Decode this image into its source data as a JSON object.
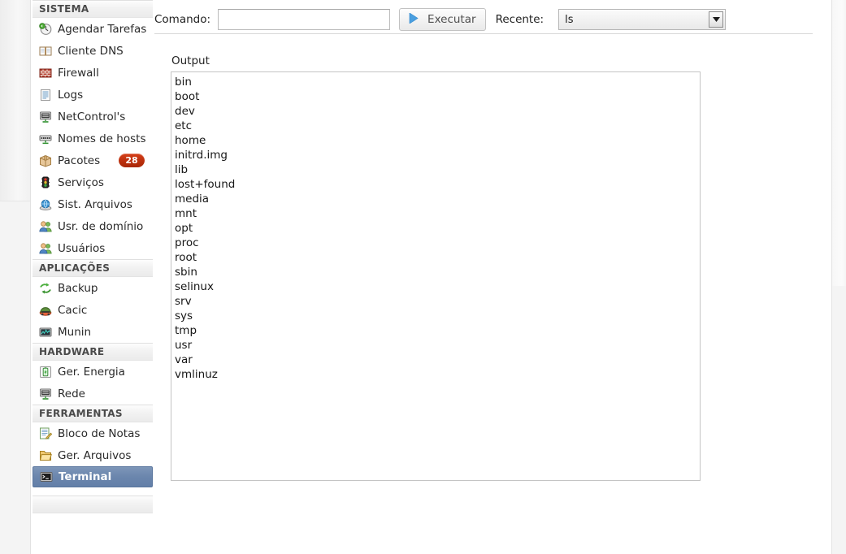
{
  "sidebar": {
    "sections": [
      {
        "title": "SISTEMA",
        "items": [
          {
            "label": "Agendar Tarefas",
            "icon": "clock-icon",
            "name": "sidebar-item-agendar-tarefas"
          },
          {
            "label": "Cliente DNS",
            "icon": "book-icon",
            "name": "sidebar-item-cliente-dns"
          },
          {
            "label": "Firewall",
            "icon": "brick-wall-icon",
            "name": "sidebar-item-firewall"
          },
          {
            "label": "Logs",
            "icon": "document-lines-icon",
            "name": "sidebar-item-logs"
          },
          {
            "label": "NetControl's",
            "icon": "monitor-network-icon",
            "name": "sidebar-item-netcontrols"
          },
          {
            "label": "Nomes de hosts",
            "icon": "hosts-icon",
            "name": "sidebar-item-nomes-de-hosts"
          },
          {
            "label": "Pacotes",
            "icon": "package-box-icon",
            "name": "sidebar-item-pacotes",
            "badge": "28"
          },
          {
            "label": "Serviços",
            "icon": "traffic-light-icon",
            "name": "sidebar-item-servicos"
          },
          {
            "label": "Sist. Arquivos",
            "icon": "disk-globe-icon",
            "name": "sidebar-item-sist-arquivos"
          },
          {
            "label": "Usr. de domínio",
            "icon": "users-icon",
            "name": "sidebar-item-usr-de-dominio"
          },
          {
            "label": "Usuários",
            "icon": "users-icon",
            "name": "sidebar-item-usuarios"
          }
        ]
      },
      {
        "title": "APLICAÇÕES",
        "items": [
          {
            "label": "Backup",
            "icon": "backup-arrows-icon",
            "name": "sidebar-item-backup"
          },
          {
            "label": "Cacic",
            "icon": "cacic-icon",
            "name": "sidebar-item-cacic"
          },
          {
            "label": "Munin",
            "icon": "graph-monitor-icon",
            "name": "sidebar-item-munin"
          }
        ]
      },
      {
        "title": "HARDWARE",
        "items": [
          {
            "label": "Ger. Energia",
            "icon": "battery-icon",
            "name": "sidebar-item-ger-energia"
          },
          {
            "label": "Rede",
            "icon": "monitor-network-icon",
            "name": "sidebar-item-rede"
          }
        ]
      },
      {
        "title": "FERRAMENTAS",
        "items": [
          {
            "label": "Bloco de Notas",
            "icon": "notepad-pencil-icon",
            "name": "sidebar-item-bloco-de-notas"
          },
          {
            "label": "Ger. Arquivos",
            "icon": "folder-open-icon",
            "name": "sidebar-item-ger-arquivos"
          },
          {
            "label": "Terminal",
            "icon": "terminal-icon",
            "name": "sidebar-item-terminal",
            "selected": true
          }
        ]
      }
    ]
  },
  "toolbar": {
    "command_label": "Comando:",
    "command_value": "",
    "command_placeholder": "",
    "execute_label": "Executar",
    "execute_icon": "play-triangle-icon",
    "recent_label": "Recente:",
    "recent_selected": "ls",
    "recent_arrow_icon": "chevron-down-icon"
  },
  "output": {
    "label": "Output",
    "lines": [
      "bin",
      "boot",
      "dev",
      "etc",
      "home",
      "initrd.img",
      "lib",
      "lost+found",
      "media",
      "mnt",
      "opt",
      "proc",
      "root",
      "sbin",
      "selinux",
      "srv",
      "sys",
      "tmp",
      "usr",
      "var",
      "vmlinuz"
    ]
  },
  "colors": {
    "selection_blue": "#6b86ad",
    "badge_red": "#bb2f0d",
    "accent_play": "#4a9fe0"
  }
}
